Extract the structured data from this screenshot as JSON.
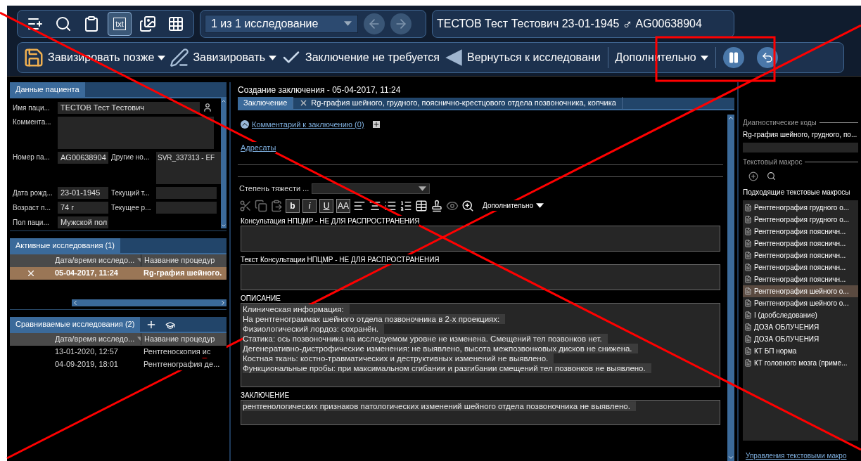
{
  "top_tools": [
    {
      "kind": "add",
      "selected": false
    },
    {
      "kind": "search",
      "selected": false
    },
    {
      "kind": "clipboard",
      "selected": false
    },
    {
      "kind": "txt",
      "label": "txt",
      "selected": true
    },
    {
      "kind": "images",
      "selected": false
    },
    {
      "kind": "grid",
      "selected": false
    }
  ],
  "study_selector": {
    "value": "1 из 1 исследование"
  },
  "patient_header": {
    "name": "ТЕСТОВ Тест Тестович 23-01-1945",
    "gender_symbol": "♂",
    "id": "AG00638904"
  },
  "actions": [
    {
      "kind": "save",
      "label": "Завизировать позже",
      "dropdown": true
    },
    {
      "kind": "sign",
      "label": "Завизировать",
      "dropdown": true
    },
    {
      "kind": "check",
      "label": "Заключение не требуется",
      "dropdown": false
    },
    {
      "kind": "back",
      "label": "Вернуться к исследовани",
      "dropdown": false
    }
  ],
  "more_menu": {
    "label": "Дополнительно"
  },
  "patient": {
    "tab": "Данные пациента",
    "name": {
      "label": "Имя паци...",
      "value": "ТЕСТОВ Тест Тестович"
    },
    "comment": {
      "label": "Коммента..."
    },
    "number": {
      "label": "Номер па...",
      "value": "AG00638904"
    },
    "other_numbers": {
      "label": "Другие но...",
      "value": "SVR_337313 - EF"
    },
    "birth_date": {
      "label": "Дата рожд...",
      "value": "23-01-1945"
    },
    "current_t": {
      "label": "Текущий т..."
    },
    "age": {
      "label": "Возраст п...",
      "value": "74 г"
    },
    "current_r": {
      "label": "Текущее р..."
    },
    "sex": {
      "label": "Пол паци...",
      "value": "Мужской пол"
    }
  },
  "active_studies": {
    "tab": "Активные исследования (1)",
    "columns": [
      "Дата/время исследо...",
      "Название процедур"
    ],
    "rows": [
      {
        "date": "05-04-2017, 11:24",
        "name": "Rg-графия шейного.",
        "selected": true
      }
    ]
  },
  "compared_studies": {
    "tab": "Сравниваемые исследования (2)",
    "columns": [
      "Дата/время исследо...",
      "Название процедур"
    ],
    "rows": [
      {
        "date": "13-01-2020, 12:57",
        "name": "Рентгеноскопия ис",
        "selected": false
      },
      {
        "date": "04-09-2019, 18:01",
        "name": "Рентгенография де...",
        "selected": false
      }
    ]
  },
  "report": {
    "title": "Создание заключения - 05-04-2017, 11:24",
    "tabs": [
      {
        "label": "Заключение",
        "selected": true,
        "closable": false
      },
      {
        "label": "Rg-графия шейного, грудного, пояснично-крестцового отдела позвоночника, копчика",
        "selected": false,
        "closable": true
      }
    ],
    "comment_link": "Комментарий к заключению (0)",
    "recipients_link": "Адресаты",
    "severity_label": "Степень тяжести ...",
    "format_tools": [
      {
        "kind": "cut",
        "disabled": true
      },
      {
        "kind": "copy",
        "disabled": true
      },
      {
        "kind": "paste",
        "disabled": true
      },
      {
        "kind": "bold",
        "label": "b",
        "disabled": false
      },
      {
        "kind": "italic",
        "label": "i",
        "disabled": false
      },
      {
        "kind": "underline",
        "label": "U",
        "disabled": false
      },
      {
        "kind": "case",
        "label": "AA",
        "disabled": false
      },
      {
        "kind": "align_left",
        "disabled": false
      },
      {
        "kind": "align_center",
        "disabled": false
      },
      {
        "kind": "list",
        "disabled": false
      },
      {
        "kind": "numbered",
        "disabled": false
      },
      {
        "kind": "table",
        "disabled": false
      },
      {
        "kind": "stamp",
        "disabled": false
      },
      {
        "kind": "eye",
        "disabled": true
      },
      {
        "kind": "preview",
        "disabled": false
      }
    ],
    "format_more": "Дополнительно",
    "sections": [
      {
        "title": "Консультация НПЦМР - НЕ ДЛЯ РАСПРОСТРАНЕНИЯ"
      },
      {
        "title": "Текст Консультации НПЦМР - НЕ ДЛЯ РАСПРОСТРАНЕНИЯ"
      },
      {
        "title": "ОПИСАНИЕ",
        "lines": [
          "Клиническая информация:",
          "На рентгенограммах шейного отдела позвоночника в 2-х проекциях:",
          "Физиологический лордоз: сохранён.",
          "Статика: ось позвоночника на исследуемом уровне не изменена. Смещений тел позвонков нет.",
          "Дегенеративно-дистрофические изменения: не выявлено, высота межпозвонковых дисков не снижена.",
          "Костная ткань: костно-травматических и деструктивных изменений не выявлено.",
          "Функциональные пробы: при максимальном сгибании и разгибании смещений тел позвонков не выявлено."
        ]
      },
      {
        "title": "ЗАКЛЮЧЕНИЕ",
        "lines": [
          "рентгенологических признаков патологических изменений шейного отдела позвоночника не выявлено."
        ]
      }
    ]
  },
  "macros_panel": {
    "codes_title": "Диагностические коды",
    "code": "Rg-графия шейного, грудного, по...",
    "macro_title": "Текстовый макрос",
    "list_title": "Подходящие текстовые макросы",
    "items": [
      {
        "label": "Рентгенография грудного о...",
        "selected": false
      },
      {
        "label": "Рентгенография грудного о...",
        "selected": false
      },
      {
        "label": "Рентгенография поясничн...",
        "selected": false
      },
      {
        "label": "Рентгенография поясничн...",
        "selected": false
      },
      {
        "label": "Рентгенография поясничн...",
        "selected": false
      },
      {
        "label": "Рентгенография поясничн...",
        "selected": false
      },
      {
        "label": "Рентгенография поясничн...",
        "selected": false
      },
      {
        "label": "Рентгенография шейного о...",
        "selected": true
      },
      {
        "label": "Рентгенография шейного о...",
        "selected": false
      },
      {
        "label": "I (дообследование)",
        "selected": false
      },
      {
        "label": "ДОЗА ОБЛУЧЕНИЯ",
        "selected": false
      },
      {
        "label": "ДОЗА ОБЛУЧЕНИЯ",
        "selected": false
      },
      {
        "label": "КТ БП норма",
        "selected": false
      },
      {
        "label": "КТ головного мозга (приме...",
        "selected": false
      }
    ],
    "manage_link": "Управления текстовыми макро"
  }
}
